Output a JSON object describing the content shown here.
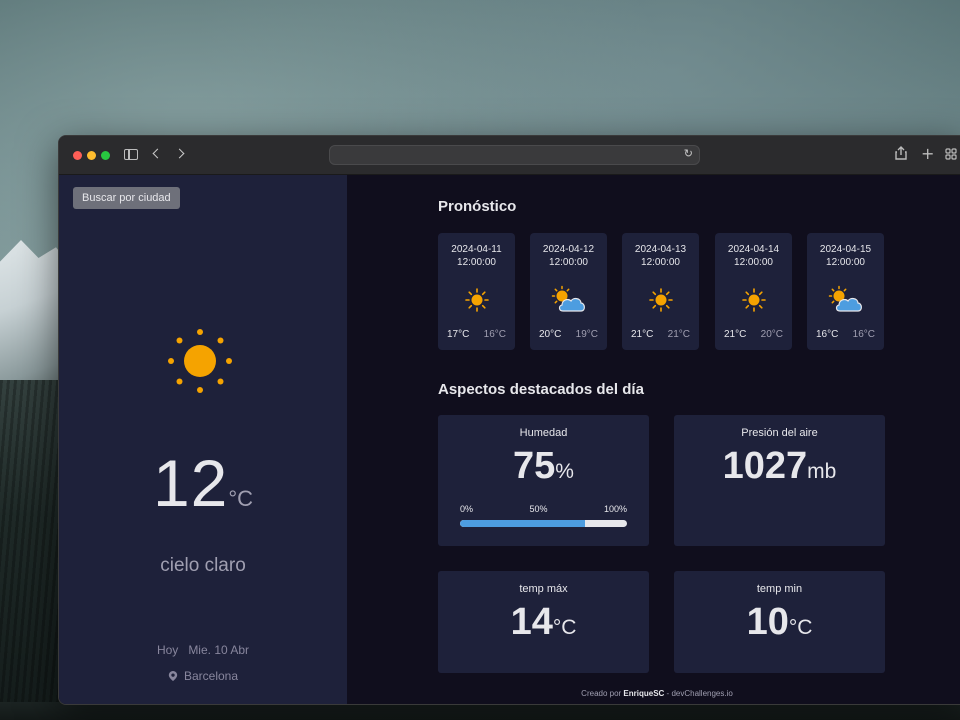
{
  "browser": {
    "address": ""
  },
  "left": {
    "search_button": "Buscar por ciudad",
    "current_icon": "sun-icon",
    "temperature": "12",
    "temperature_unit": "°C",
    "description": "cielo claro",
    "today": "Hoy",
    "date": "Mie. 10 Abr",
    "location_icon": "map-pin-icon",
    "location": "Barcelona"
  },
  "forecast": {
    "title": "Pronóstico",
    "days": [
      {
        "date": "2024-04-11",
        "time": "12:00:00",
        "icon": "sun-icon",
        "max": "17°C",
        "min": "16°C"
      },
      {
        "date": "2024-04-12",
        "time": "12:00:00",
        "icon": "partly-cloudy-icon",
        "max": "20°C",
        "min": "19°C"
      },
      {
        "date": "2024-04-13",
        "time": "12:00:00",
        "icon": "sun-icon",
        "max": "21°C",
        "min": "21°C"
      },
      {
        "date": "2024-04-14",
        "time": "12:00:00",
        "icon": "sun-icon",
        "max": "21°C",
        "min": "20°C"
      },
      {
        "date": "2024-04-15",
        "time": "12:00:00",
        "icon": "partly-cloudy-icon",
        "max": "16°C",
        "min": "16°C"
      }
    ]
  },
  "highlights": {
    "title": "Aspectos destacados del día",
    "humidity": {
      "label": "Humedad",
      "value": "75",
      "unit": "%",
      "bar_min": "0%",
      "bar_mid": "50%",
      "bar_max": "100%",
      "fill_percent": 75
    },
    "pressure": {
      "label": "Presión del aire",
      "value": "1027",
      "unit": "mb"
    },
    "temp_max": {
      "label": "temp máx",
      "value": "14",
      "unit": "°C"
    },
    "temp_min": {
      "label": "temp min",
      "value": "10",
      "unit": "°C"
    }
  },
  "footer": {
    "prefix": "Creado por ",
    "author": "EnriqueSC",
    "suffix": " - devChallenges.io"
  },
  "colors": {
    "sun": "#f5a300",
    "cloud": "#4d9de0",
    "bar_fill": "#4d9de0",
    "panel": "#1e213a",
    "background": "#100e1d"
  }
}
